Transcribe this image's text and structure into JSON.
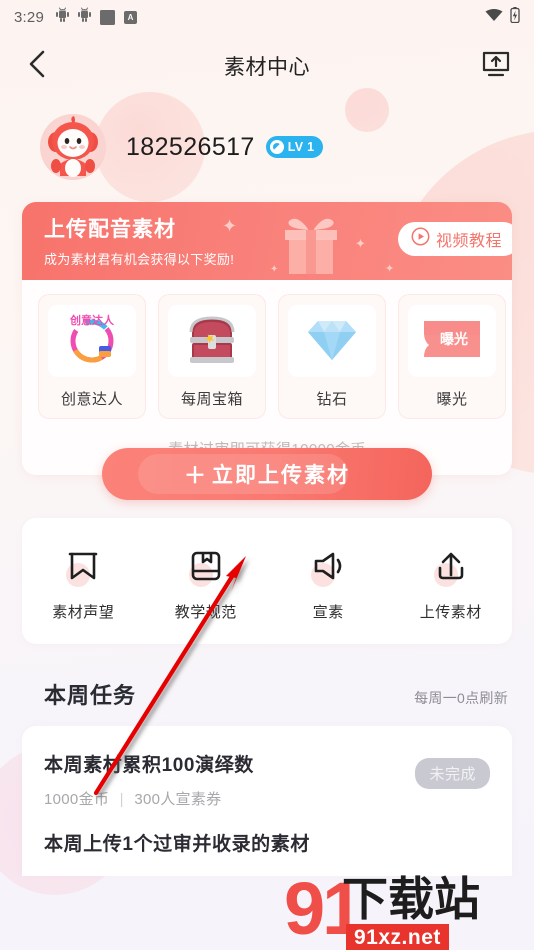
{
  "status_bar": {
    "time": "3:29",
    "icons": [
      "android-icon",
      "android-icon",
      "square-icon",
      "letter-a-icon"
    ],
    "right_icons": [
      "wifi-icon",
      "battery-icon"
    ]
  },
  "nav": {
    "back_icon": "chevron-left-icon",
    "title": "素材中心",
    "action_icon": "upload-to-screen-icon"
  },
  "profile": {
    "avatar_icon": "mascot-avatar",
    "user_id": "182526517",
    "level_badge": "LV 1",
    "level_badge_color": "#2bb3ef"
  },
  "banner": {
    "title": "上传配音素材",
    "subtitle": "成为素材君有机会获得以下奖励!",
    "tutorial_label": "视频教程",
    "tutorial_icon": "play-circle-icon",
    "gift_icon": "gift-box-icon",
    "accent_color": "#f9807a",
    "rewards": [
      {
        "label": "创意达人",
        "icon": "creative-circle-icon"
      },
      {
        "label": "每周宝箱",
        "icon": "treasure-chest-icon"
      },
      {
        "label": "钻石",
        "icon": "diamond-icon"
      },
      {
        "label": "曝光",
        "icon": "exposure-ticket-icon"
      }
    ],
    "hint": "素材过审即可获得10000金币",
    "cta_plus": "＋",
    "cta_label": "立即上传素材",
    "cta_color": "#f4655c"
  },
  "quick_menu": [
    {
      "label": "素材声望",
      "icon": "bookmark-icon"
    },
    {
      "label": "教学规范",
      "icon": "book-icon"
    },
    {
      "label": "宣素",
      "icon": "megaphone-icon"
    },
    {
      "label": "上传素材",
      "icon": "upload-icon"
    }
  ],
  "tasks": {
    "title": "本周任务",
    "refresh_note": "每周一0点刷新",
    "items": [
      {
        "name": "本周素材累积100演绎数",
        "reward_coins": "1000金币",
        "reward_sep": "|",
        "reward_ticket": "300人宣素券",
        "status": "未完成"
      },
      {
        "name": "本周上传1个过审并收录的素材",
        "reward_coins": "",
        "reward_sep": "",
        "reward_ticket": "",
        "status": ""
      }
    ]
  },
  "annotation": {
    "arrow_color": "#e60000",
    "points_to": "立即上传素材"
  },
  "watermark": {
    "number": "91",
    "chinese": "下载站",
    "domain": "91xz.net"
  }
}
